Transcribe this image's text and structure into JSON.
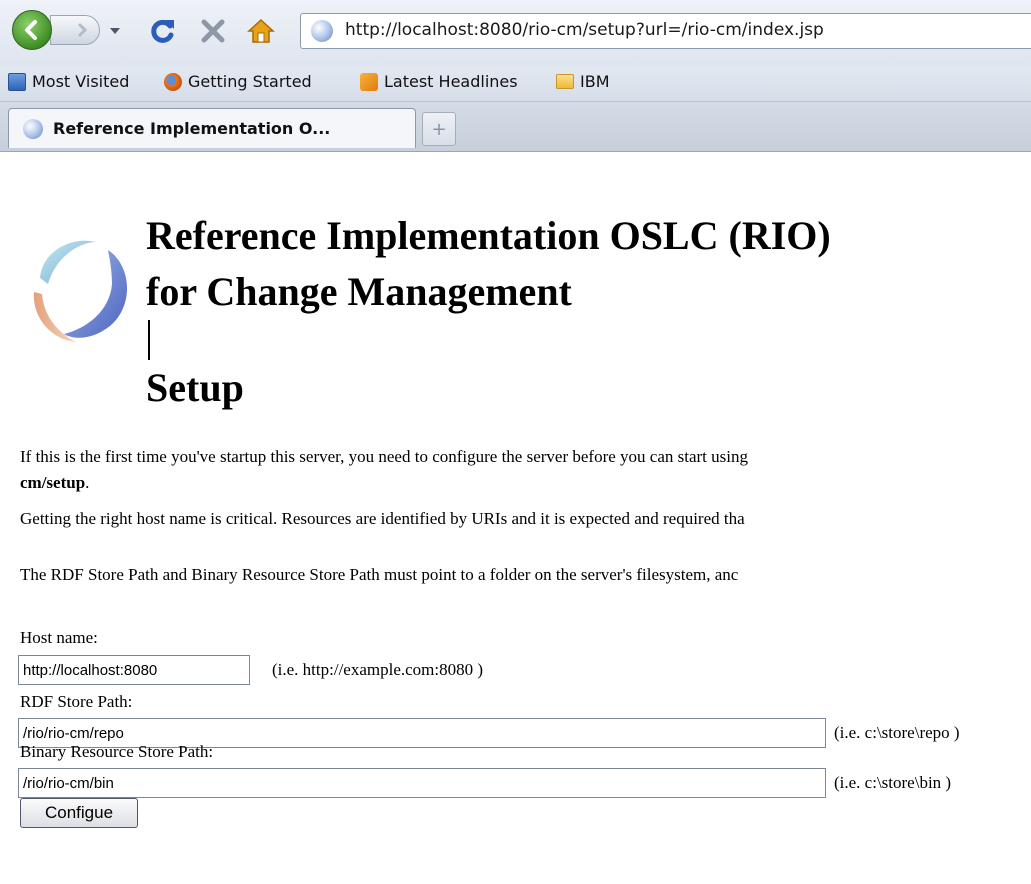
{
  "browser": {
    "url": "http://localhost:8080/rio-cm/setup?url=/rio-cm/index.jsp",
    "bookmarks": [
      "Most Visited",
      "Getting Started",
      "Latest Headlines",
      "IBM"
    ],
    "tab_title": "Reference Implementation O...",
    "new_tab_glyph": "+"
  },
  "page": {
    "heading_lines": [
      "Reference Implementation OSLC (RIO)",
      "for Change Management",
      "Setup"
    ],
    "para1_line1": "If this is the first time you've startup this server, you need to configure the server before you can start using",
    "para1_line2_bold": "cm/setup",
    "para1_line2_end": ".",
    "para2": "Getting the right host name is critical. Resources are identified by URIs and it is expected and required tha",
    "para3": "The RDF Store Path and Binary Resource Store Path must point to a folder on the server's filesystem, anc"
  },
  "form": {
    "host_label": "Host name:",
    "host_value": "http://localhost:8080",
    "host_hint": "(i.e. http://example.com:8080 )",
    "rdf_label": "RDF Store Path:",
    "rdf_value": "/rio/rio-cm/repo",
    "rdf_hint": "(i.e. c:\\store\\repo )",
    "bin_label": "Binary Resource Store Path:",
    "bin_value": "/rio/rio-cm/bin",
    "bin_hint": "(i.e. c:\\store\\bin )",
    "submit_label": "Configue"
  },
  "icons": {
    "back": "back-arrow-icon",
    "forward": "forward-arrow-icon",
    "history": "history-dropdown-icon",
    "reload": "reload-icon",
    "stop": "stop-icon",
    "home": "home-icon"
  },
  "colors": {
    "back_button": "#4a9a2b",
    "reload": "#2c5db8",
    "stop": "#8d97a6",
    "home": "#e8a21a"
  }
}
